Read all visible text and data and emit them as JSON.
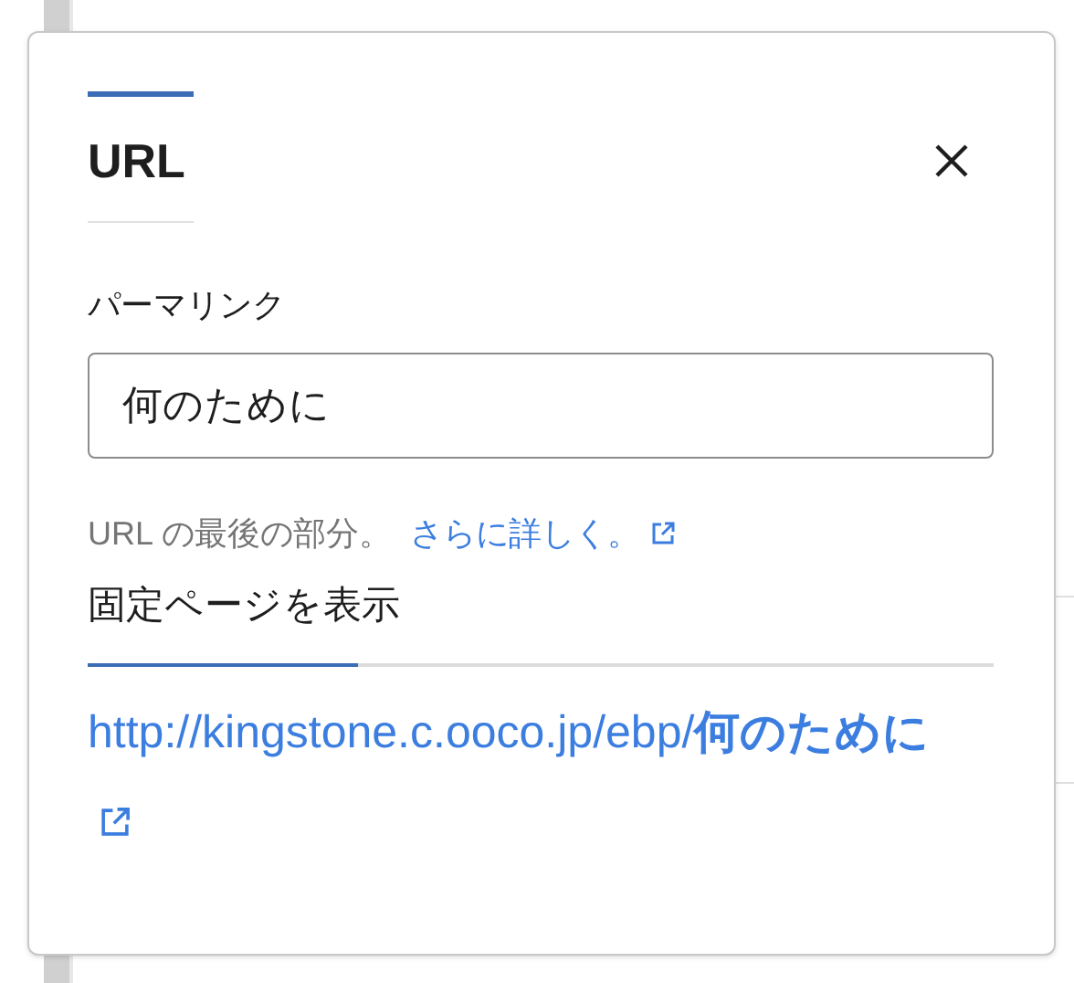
{
  "panel": {
    "title": "URL",
    "permalink": {
      "label": "パーマリンク",
      "value": "何のために"
    },
    "help": {
      "text": "URL の最後の部分。",
      "link": "さらに詳しく。"
    },
    "view_page": {
      "label": "固定ページを表示",
      "url": "http://kingstone.c.ooco.jp/ebp/**何のために**"
    }
  }
}
